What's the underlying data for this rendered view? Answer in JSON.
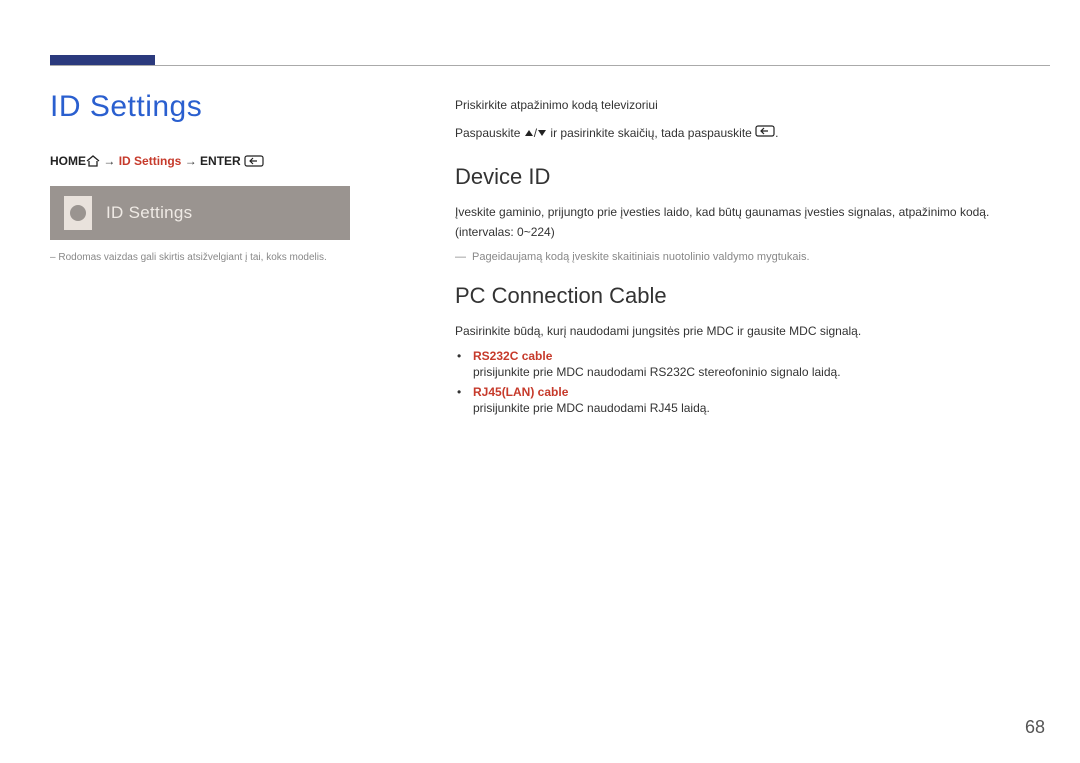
{
  "page_number": "68",
  "title": "ID Settings",
  "breadcrumb": {
    "home_label": "HOME",
    "arrow": " → ",
    "id_settings": "ID Settings",
    "enter_label": "ENTER"
  },
  "screenshot": {
    "label": "ID Settings"
  },
  "left_note": "Rodomas vaizdas gali skirtis atsižvelgiant į tai, koks modelis.",
  "intro": {
    "line1": "Priskirkite atpažinimo kodą televizoriui",
    "line2_prefix": "Paspauskite ",
    "line2_mid": " ir pasirinkite skaičių, tada paspauskite ",
    "line2_suffix": "."
  },
  "device_id": {
    "heading": "Device ID",
    "text": "Įveskite gaminio, prijungto prie įvesties laido, kad būtų gaunamas įvesties signalas, atpažinimo kodą. (intervalas: 0~224)",
    "note": "Pageidaujamą kodą įveskite skaitiniais nuotolinio valdymo mygtukais."
  },
  "pc_connection": {
    "heading": "PC Connection Cable",
    "intro": "Pasirinkite būdą, kurį naudodami jungsitės prie MDC ir gausite MDC signalą.",
    "items": [
      {
        "name": "RS232C cable",
        "desc": "prisijunkite prie MDC naudodami RS232C stereofoninio signalo laidą."
      },
      {
        "name": "RJ45(LAN) cable",
        "desc": "prisijunkite prie MDC naudodami RJ45 laidą."
      }
    ]
  }
}
